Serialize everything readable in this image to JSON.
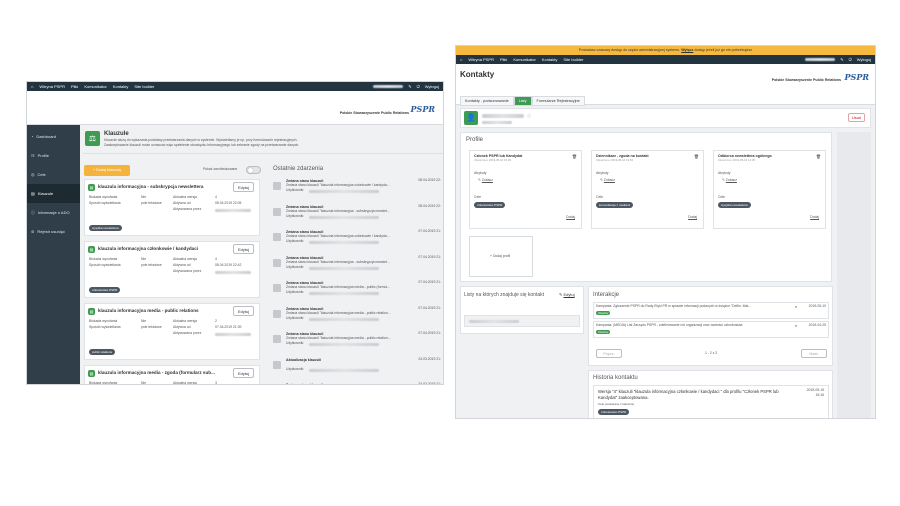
{
  "left": {
    "nav": [
      "Witryna PSPR",
      "Pliki",
      "Komunikator",
      "Kontakty",
      "Site builder"
    ],
    "logout": "Wyloguj",
    "org_name": "Polskie Stowarzyszenie Public Relations",
    "logo_text": "PSPR",
    "sidebar": [
      "Dashboard",
      "Profile",
      "Cele",
      "Klauzule",
      "Informacje o ADO",
      "Rejestr usunięć"
    ],
    "klauzule": {
      "title": "Klauzule",
      "desc1": "Klauzule służą do wykazania podstawy przetwarzania danych w systemie. Wyświetlamy je np. przy formularzach rejestracyjnych.",
      "desc2": "Zaakceptowanie klauzuli może oznaczać więc spełnienie obowiązku informacyjnego lub zebranie zgody na przetwarzanie danych.",
      "add_button": "+ Dodaj klauzulę",
      "show_archived": "Pokaż zarchiwizowane",
      "events_title": "Ostatnie zdarzenia"
    },
    "clauses": [
      {
        "title": "klauzula informacyjna - subskrypcja newslettera",
        "edit": "Edytuj",
        "r1": [
          "Blokada wycofania",
          "Nie",
          "Aktualna wersja",
          "4"
        ],
        "r2": [
          "Sposób wyświetlania",
          "pole tekstowe",
          "Aktywna od",
          "08.04.2019 22:05"
        ],
        "r3": "Aktywowana przez",
        "tag": "wysyłka newslettera"
      },
      {
        "title": "klauzula informacyjna członkowie / kandydaci",
        "edit": "Edytuj",
        "r1": [
          "Blokada wycofania",
          "Nie",
          "Aktualna wersja",
          "4"
        ],
        "r2": [
          "Sposób wyświetlania",
          "pole tekstowe",
          "Aktywna od",
          "08.04.2019 22:42"
        ],
        "r3": "Aktywowana przez",
        "tag": "członkostwo PSPR"
      },
      {
        "title": "klauzula informacyjna media - public relations",
        "edit": "Edytuj",
        "r1": [
          "Blokada wycofania",
          "Nie",
          "Aktualna wersja",
          "2"
        ],
        "r2": [
          "Sposób wyświetlania",
          "pole tekstowe",
          "Aktywna od",
          "07.04.2019 21:39"
        ],
        "r3": "Aktywowana przez",
        "tag": "public relations"
      },
      {
        "title": "klauzula informacyjna media - zgoda (formularz sub...",
        "edit": "Edytuj",
        "r1": [
          "Blokada wycofania",
          "Nie",
          "Aktualna wersja",
          "3"
        ]
      }
    ],
    "events": [
      {
        "title": "Zmiana stanu klauzuli",
        "desc": "Zmiana stanu klauzuli \"klauzula informacyjna członkowie / kandyda...",
        "user": "Użytkownik:",
        "date": "08.04.2019 22:"
      },
      {
        "title": "Zmiana stanu klauzuli",
        "desc": "Zmiana stanu klauzuli \"klauzula informacyjna - subskrypcja newslet...",
        "user": "Użytkownik:",
        "date": "08.04.2019 22:"
      },
      {
        "title": "Zmiana stanu klauzuli",
        "desc": "Zmiana stanu klauzuli \"klauzula informacyjna członkowie / kandyda...",
        "user": "Użytkownik:",
        "date": "07.04.2019 21:"
      },
      {
        "title": "Zmiana stanu klauzuli",
        "desc": "Zmiana stanu klauzuli \"klauzula informacyjna - subskrypcja newslet...",
        "user": "Użytkownik:",
        "date": "07.04.2019 21:"
      },
      {
        "title": "Zmiana stanu klauzuli",
        "desc": "Zmiana stanu klauzuli \"klauzula informacyjna media - public (formul...",
        "user": "Użytkownik:",
        "date": "07.04.2019 21:"
      },
      {
        "title": "Zmiana stanu klauzuli",
        "desc": "Zmiana stanu klauzuli \"klauzula informacyjna media - public relation...",
        "user": "Użytkownik:",
        "date": "07.04.2019 21:"
      },
      {
        "title": "Zmiana stanu klauzuli",
        "desc": "Zmiana stanu klauzuli \"klauzula informacyjna media - public relation...",
        "user": "Użytkownik:",
        "date": "07.04.2019 21:"
      },
      {
        "title": "Aktualizacja klauzuli",
        "desc": "",
        "user": "Użytkownik:",
        "date": "24.03.2019 21:"
      },
      {
        "title": "Zmiana stanu klauzuli",
        "desc": "Zmiana stanu klauzuli \"klauzula informacyjna media - public relation...",
        "user": "Użytkownik:",
        "date": "24.03.2019 21:"
      }
    ]
  },
  "right": {
    "notice": "Posiadasz czasowy dostęp do części administracyjnej systemu.",
    "notice_link": "Wyłącz",
    "notice_rest": "dostęp jeżeli już go nie potrzebujesz",
    "nav": [
      "Witryna PSPR",
      "Pliki",
      "Komunikator",
      "Kontakty",
      "Site builder"
    ],
    "logout": "Wyloguj",
    "page_title": "Kontakty",
    "org_name": "Polskie Stowarzyszenie Public Relations",
    "logo_text": "PSPR",
    "tabs": [
      "Kontakty - podsumowanie",
      "Listy",
      "Formularze Rejestracyjne"
    ],
    "delete_button": "Usuń",
    "profile_title": "Profile",
    "profiles": [
      {
        "title": "Członek PSPR lub Kandydat",
        "sub": "Utworzono: 2019-05-10 15:36",
        "attr_label": "Atrybuty",
        "attr_link": "Zobacz",
        "goals_label": "Cele",
        "tag": "członkostwo PSPR",
        "add": "Dodaj"
      },
      {
        "title": "Dziennikarz - zgoda na kontakt",
        "sub": "Utworzono: 2019-05-10 13:52",
        "attr_label": "Atrybuty",
        "attr_link": "Zobacz",
        "goals_label": "Cele",
        "tag": "komunikacja z mediami",
        "add": "Dodaj"
      },
      {
        "title": "Odbiorca newslettera ogólnego",
        "sub": "Utworzono: 2019-05-10 13:05",
        "attr_label": "Atrybuty",
        "attr_link": "Zobacz",
        "goals_label": "Cele",
        "tag": "wysyłka newslettera",
        "add": "Dodaj"
      }
    ],
    "add_profile": "Dodaj profil",
    "lists_title": "Listy na których znajduje się kontakt",
    "lists_edit": "Edytuj",
    "interactions_title": "Interakcje",
    "interactions": [
      {
        "text": "Kampania: Zgłoszenie PSPR do Rady Etyki PR w sprawie informacji podanych w książce \"Delfin. Mat...",
        "badge": "Otwarty",
        "date": "2019-05-10"
      },
      {
        "text": "Kampania: (MEDIA) List Zarządu PSPR - zdefiniowanie roli organizacji oraz wartości członkostwa",
        "badge": "Otwarty",
        "date": "2019-04-25"
      }
    ],
    "pagination_prev": "Poprz.",
    "pagination": "1 - 2 z 2",
    "pagination_next": "Nast.",
    "history_title": "Historia kontaktu",
    "history": {
      "text": "Wersja \"4\" klauzuli \"klauzula informacyjna członkowie / kandydaci \" dla profilu \"Członek PSPR lub Kandydat\" zaakceptowana.",
      "date": "2019-05-15",
      "time": "15:16",
      "goals_label": "Cele powiązane z klauzulą:",
      "tag": "członkostwo PSPR"
    }
  }
}
